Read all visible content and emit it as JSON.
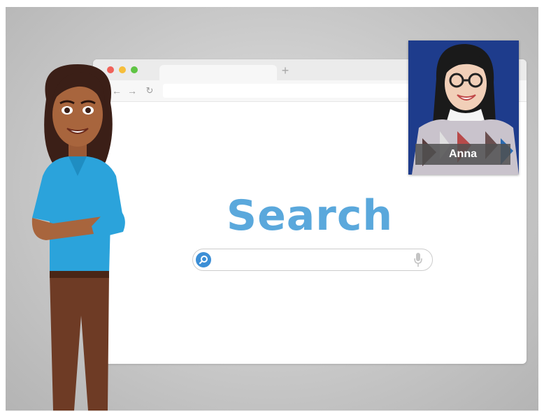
{
  "browser": {
    "new_tab_label": "+",
    "back_icon": "back-arrow-icon",
    "forward_icon": "forward-arrow-icon",
    "reload_icon": "reload-icon",
    "url_value": "",
    "page": {
      "title": "Search",
      "search": {
        "value": "",
        "icon": "magnifier-icon",
        "mic_icon": "microphone-icon"
      }
    }
  },
  "video_call": {
    "participant_name": "Anna"
  },
  "colors": {
    "search_title": "#5aa8dc",
    "close_dot": "#f0625a",
    "minimize_dot": "#f6be3b",
    "maximize_dot": "#5fc443",
    "video_background": "#1e3c8c",
    "shirt": "#2ba3db"
  }
}
